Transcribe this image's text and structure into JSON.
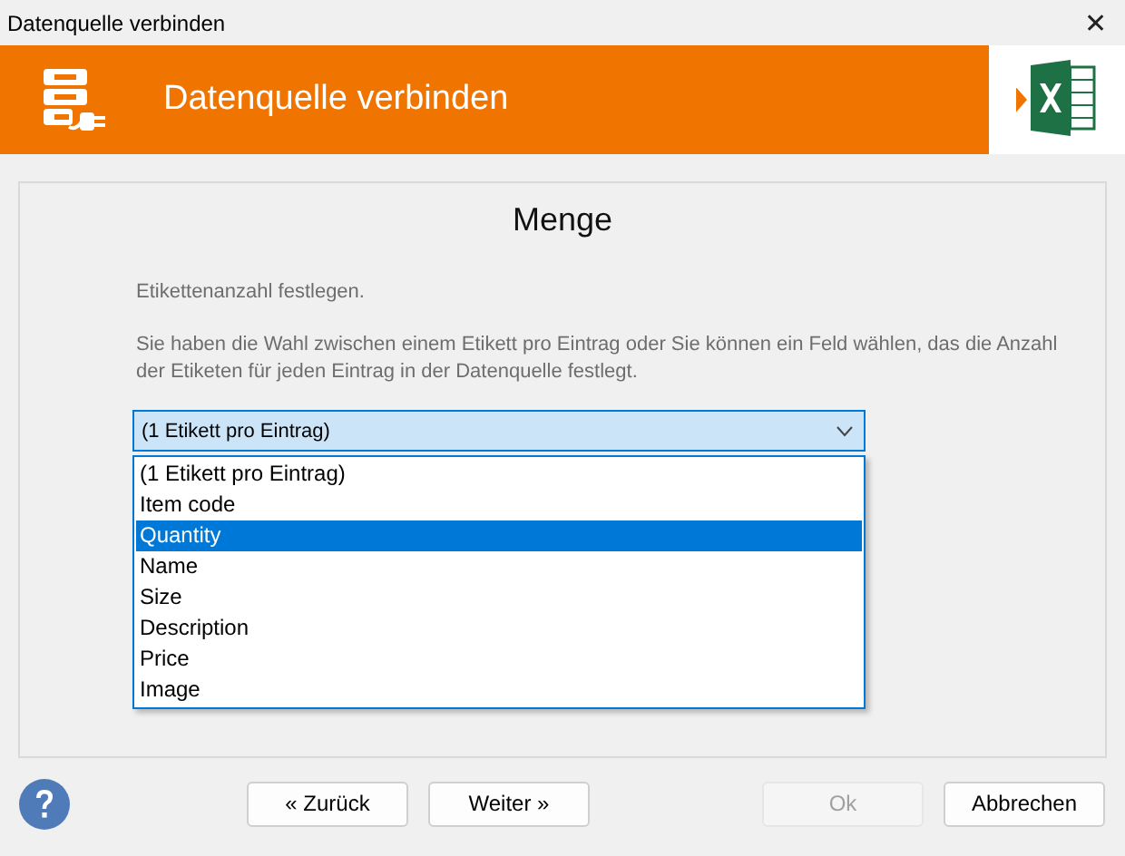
{
  "window": {
    "title": "Datenquelle verbinden",
    "close": "✕"
  },
  "banner": {
    "title": "Datenquelle verbinden"
  },
  "panel": {
    "heading": "Menge",
    "intro": "Etikettenanzahl festlegen.",
    "description": "Sie haben die Wahl zwischen einem Etikett pro Eintrag oder Sie können ein Feld wählen, das die Anzahl der Etiketen für jeden Eintrag in der Datenquelle festlegt.",
    "dropdown": {
      "value": "(1 Etikett pro Eintrag)",
      "expanded": true,
      "options": [
        {
          "label": "(1 Etikett pro Eintrag)",
          "highlighted": false
        },
        {
          "label": "Item code",
          "highlighted": false
        },
        {
          "label": "Quantity",
          "highlighted": true
        },
        {
          "label": "Name",
          "highlighted": false
        },
        {
          "label": "Size",
          "highlighted": false
        },
        {
          "label": "Description",
          "highlighted": false
        },
        {
          "label": "Price",
          "highlighted": false
        },
        {
          "label": "Image",
          "highlighted": false
        }
      ]
    }
  },
  "buttons": [
    {
      "label": "« Zurück",
      "disabled": false
    },
    {
      "label": "Weiter »",
      "disabled": false
    },
    {
      "label": "Ok",
      "disabled": true
    },
    {
      "label": "Abbrechen",
      "disabled": false
    }
  ]
}
